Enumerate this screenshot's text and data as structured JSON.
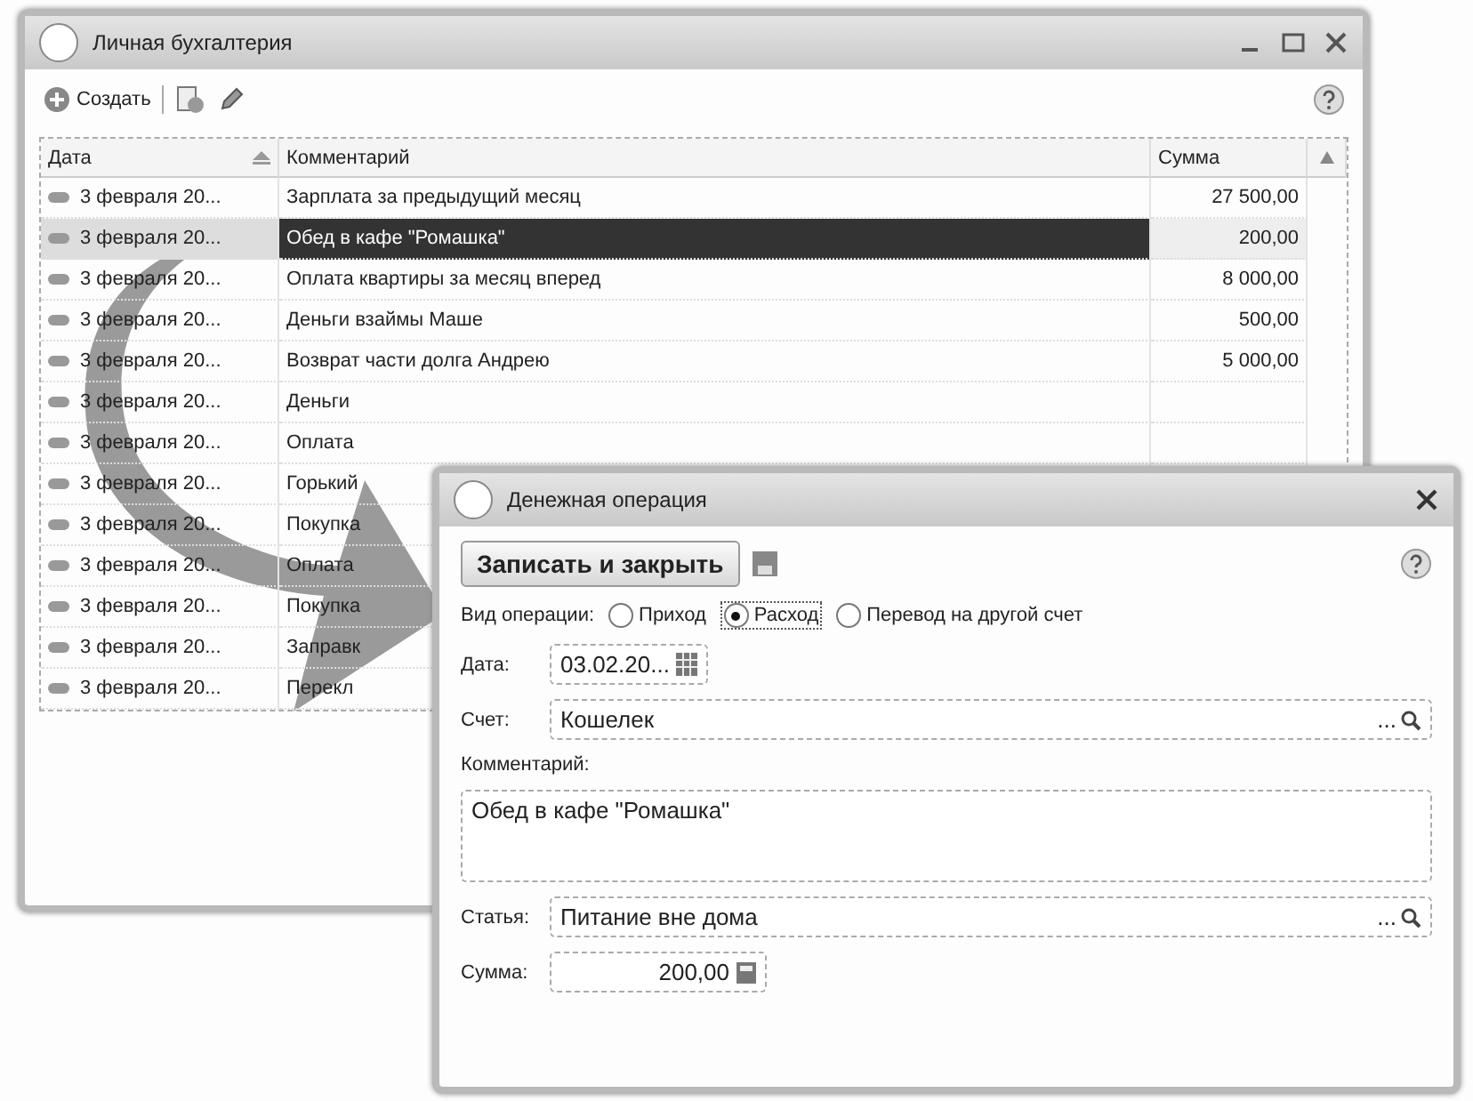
{
  "main_window": {
    "title": "Личная бухгалтерия",
    "toolbar": {
      "create_label": "Создать"
    },
    "table": {
      "columns": [
        "Дата",
        "Комментарий",
        "Сумма"
      ],
      "rows": [
        {
          "date": "3 февраля 20...",
          "comment": "Зарплата за предыдущий месяц",
          "amount": "27 500,00",
          "selected": false
        },
        {
          "date": "3 февраля 20...",
          "comment": "Обед в кафе \"Ромашка\"",
          "amount": "200,00",
          "selected": true
        },
        {
          "date": "3 февраля 20...",
          "comment": "Оплата квартиры за месяц вперед",
          "amount": "8 000,00",
          "selected": false
        },
        {
          "date": "3 февраля 20...",
          "comment": "Деньги взаймы Маше",
          "amount": "500,00",
          "selected": false
        },
        {
          "date": "3 февраля 20...",
          "comment": "Возврат части долга Андрею",
          "amount": "5 000,00",
          "selected": false
        },
        {
          "date": "3 февраля 20...",
          "comment": "Деньги",
          "selected": false
        },
        {
          "date": "3 февраля 20...",
          "comment": "Оплата",
          "selected": false
        },
        {
          "date": "3 февраля 20...",
          "comment": "Горький",
          "selected": false
        },
        {
          "date": "3 февраля 20...",
          "comment": "Покупка",
          "selected": false
        },
        {
          "date": "3 февраля 20...",
          "comment": "Оплата",
          "selected": false
        },
        {
          "date": "3 февраля 20...",
          "comment": "Покупка",
          "selected": false
        },
        {
          "date": "3 февраля 20...",
          "comment": "Заправк",
          "selected": false
        },
        {
          "date": "3 февраля 20...",
          "comment": "Перекл",
          "selected": false
        }
      ]
    }
  },
  "dialog": {
    "title": "Денежная операция",
    "save_button": "Записать и закрыть",
    "operation_type": {
      "label": "Вид операции:",
      "options": [
        {
          "label": "Приход",
          "selected": false
        },
        {
          "label": "Расход",
          "selected": true
        },
        {
          "label": "Перевод на другой счет",
          "selected": false
        }
      ]
    },
    "date": {
      "label": "Дата:",
      "value": "03.02.20..."
    },
    "account": {
      "label": "Счет:",
      "value": "Кошелек",
      "choose": "..."
    },
    "comment": {
      "label": "Комментарий:",
      "value": "Обед в кафе \"Ромашка\""
    },
    "article": {
      "label": "Статья:",
      "value": "Питание вне дома",
      "choose": "..."
    },
    "amount": {
      "label": "Сумма:",
      "value": "200,00"
    }
  }
}
